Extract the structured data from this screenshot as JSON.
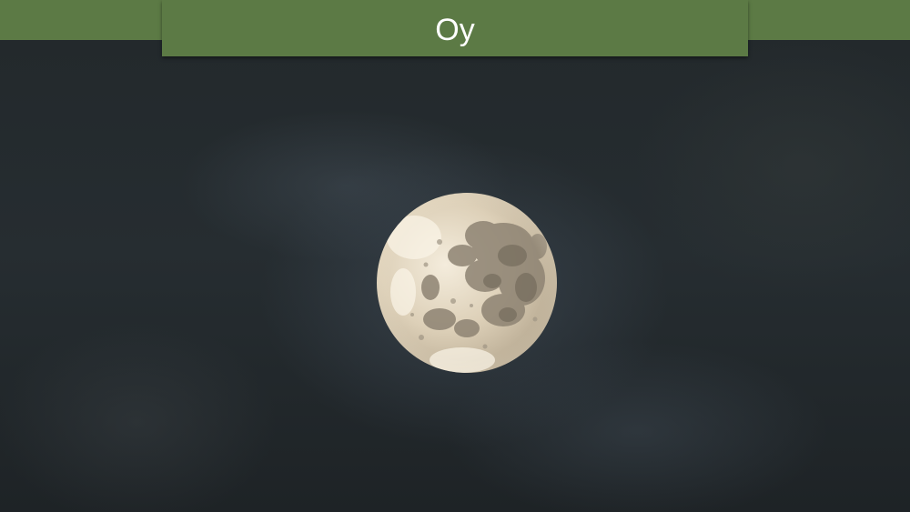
{
  "slide": {
    "title": "Oy",
    "background_image": "full-moon-night-sky",
    "colors": {
      "title_bar": "#5c7a45",
      "title_text": "#ffffff",
      "sky": "#23292c",
      "moon_light": "#efe6d4",
      "moon_maria": "#8a8070"
    }
  }
}
